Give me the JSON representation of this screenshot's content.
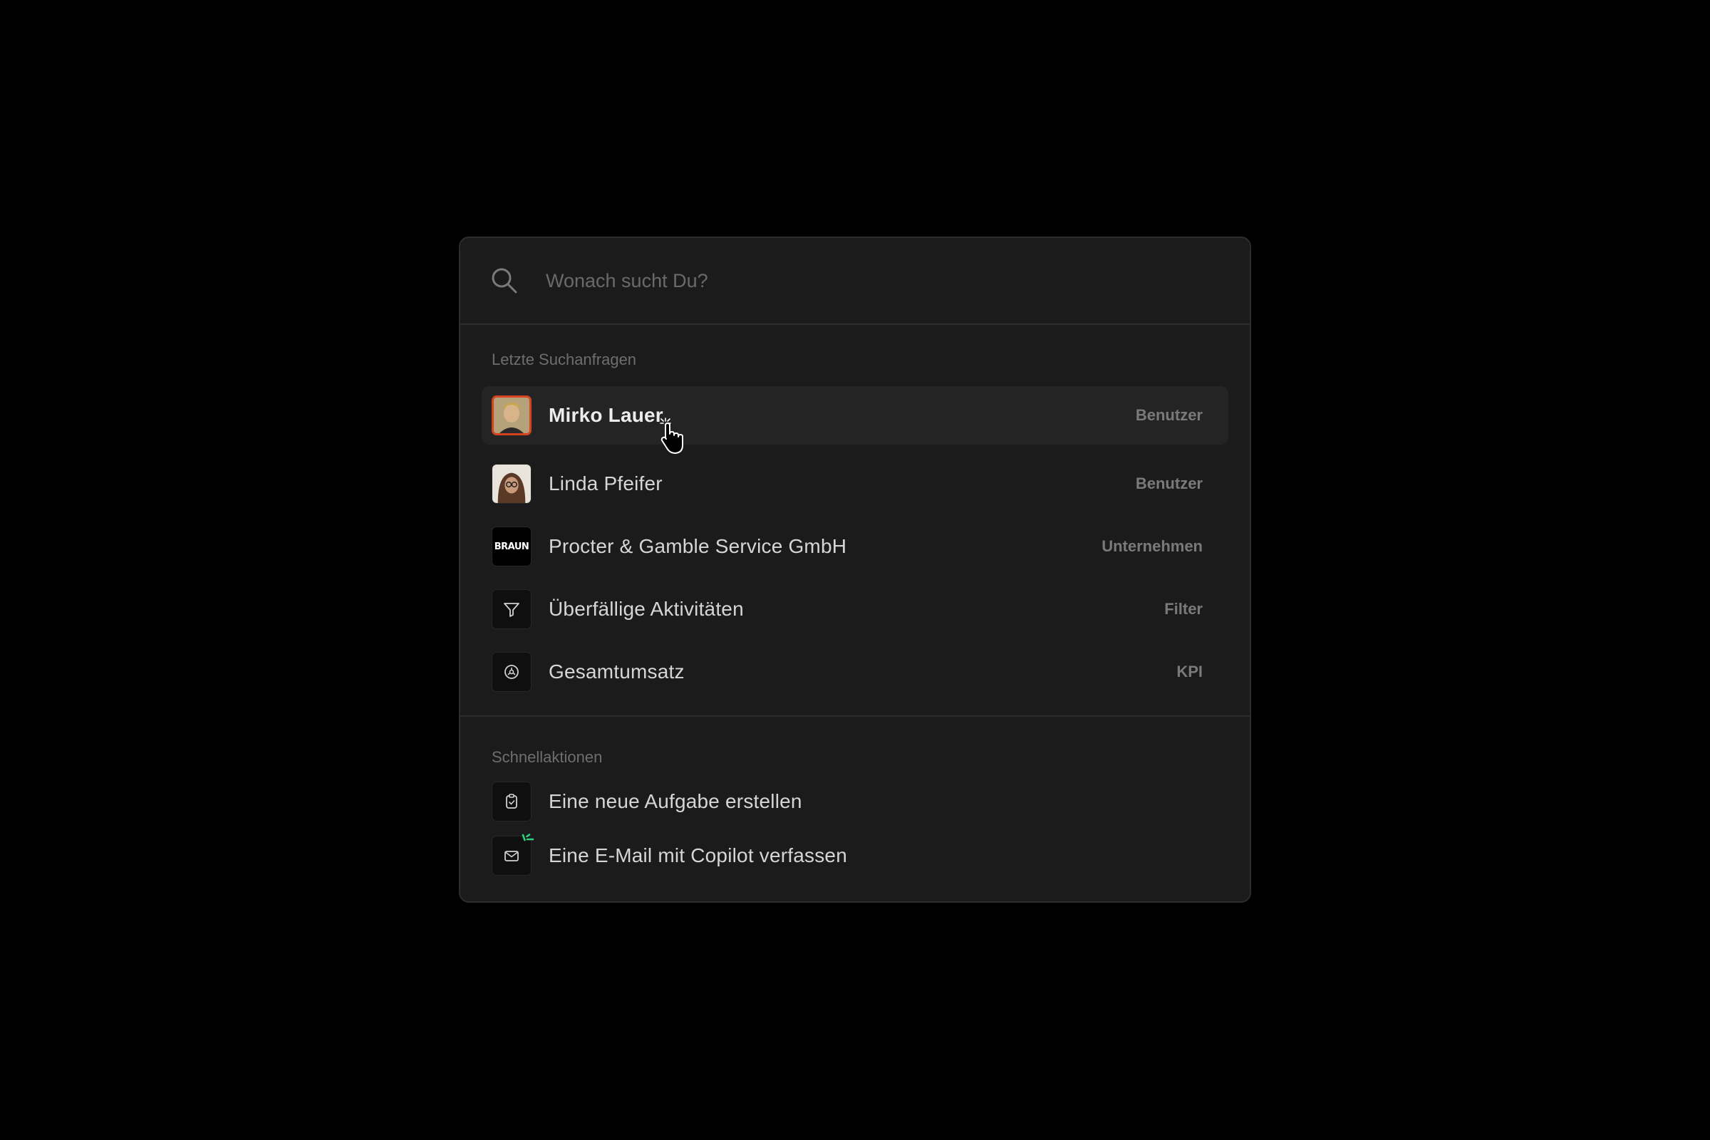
{
  "search": {
    "placeholder": "Wonach sucht Du?",
    "icon": "search-icon"
  },
  "recent": {
    "title": "Letzte Suchanfragen",
    "items": [
      {
        "label": "Mirko Lauer",
        "type": "Benutzer",
        "icon": "avatar",
        "active": true
      },
      {
        "label": "Linda Pfeifer",
        "type": "Benutzer",
        "icon": "avatar"
      },
      {
        "label": "Procter & Gamble Service GmbH",
        "type": "Unternehmen",
        "icon": "company-logo",
        "logo_text": "BRAUN"
      },
      {
        "label": "Überfällige Aktivitäten",
        "type": "Filter",
        "icon": "filter-icon"
      },
      {
        "label": "Gesamtumsatz",
        "type": "KPI",
        "icon": "kpi-gauge-icon"
      }
    ]
  },
  "quick": {
    "title": "Schnellaktionen",
    "items": [
      {
        "label": "Eine neue Aufgabe erstellen",
        "icon": "clipboard-icon"
      },
      {
        "label": "Eine E-Mail mit Copilot verfassen",
        "icon": "mail-icon"
      }
    ]
  },
  "colors": {
    "background": "#000000",
    "panel": "#1b1b1b",
    "active_row": "#242424",
    "avatar_border": "#d8431f",
    "copilot_accent": "#2fd27a"
  }
}
